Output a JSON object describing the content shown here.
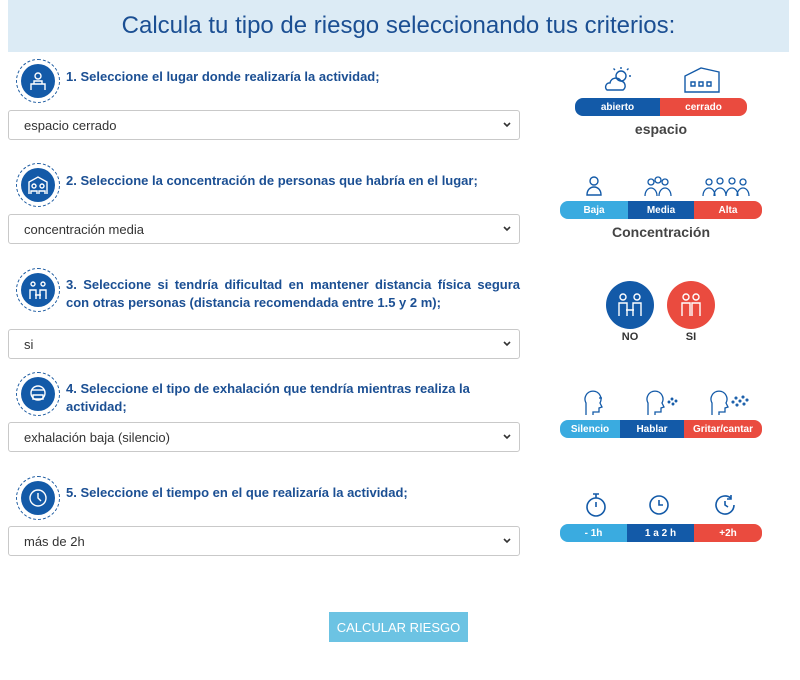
{
  "header": {
    "title": "Calcula tu tipo de riesgo seleccionando tus criterios:"
  },
  "questions": [
    {
      "label": "1. Seleccione el lugar donde realizaría la actividad;",
      "value": "espacio cerrado"
    },
    {
      "label": "2. Seleccione la concentración de personas que habría en el lugar;",
      "value": "concentración media"
    },
    {
      "label": "3. Seleccione si tendría dificultad en mantener distancia física segura con otras personas (distancia recomendada entre 1.5 y 2 m);",
      "value": "si"
    },
    {
      "label": "4. Seleccione el tipo de exhalación que tendría mientras realiza la actividad;",
      "value": "exhalación baja (silencio)"
    },
    {
      "label": "5. Seleccione el tiempo en el que realizaría la actividad;",
      "value": "más de 2h"
    }
  ],
  "legend": {
    "espacio": {
      "options": [
        "abierto",
        "cerrado"
      ],
      "caption": "espacio"
    },
    "concentracion": {
      "options": [
        "Baja",
        "Media",
        "Alta"
      ],
      "caption": "Concentración"
    },
    "distancia": {
      "options": [
        "NO",
        "SI"
      ]
    },
    "exhalacion": {
      "options": [
        "Silencio",
        "Hablar",
        "Gritar/cantar"
      ]
    },
    "tiempo": {
      "options": [
        "- 1h",
        "1 a 2 h",
        "+2h"
      ]
    }
  },
  "colors": {
    "light_blue": "#3aabe0",
    "dark_blue": "#135aa8",
    "red": "#ea4b3f"
  },
  "button": {
    "label": "CALCULAR RIESGO"
  }
}
